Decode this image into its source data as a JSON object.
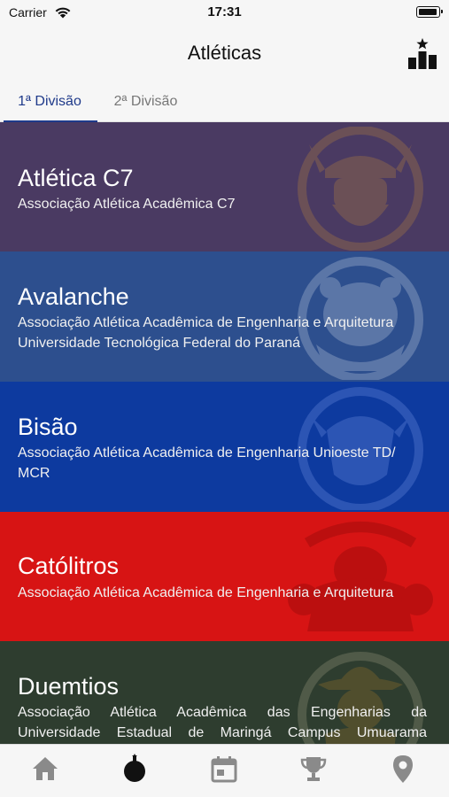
{
  "status_bar": {
    "carrier": "Carrier",
    "time": "17:31"
  },
  "header": {
    "title": "Atléticas",
    "ranking_icon": "podium-icon"
  },
  "tabs": [
    {
      "label": "1ª Divisão",
      "selected": true
    },
    {
      "label": "2ª Divisão",
      "selected": false
    }
  ],
  "teams": [
    {
      "name": "Atlética C7",
      "description": "Associação Atlética Acadêmica C7",
      "color": "#4a3a62",
      "emblem": "viking-emblem"
    },
    {
      "name": "Avalanche",
      "description": "Associação Atlética Acadêmica de Engenharia e Arquitetura Universidade Tecnológica Federal do Paraná",
      "color": "#2d4f8e",
      "emblem": "polar-bear-emblem"
    },
    {
      "name": "Bisão",
      "description": "Associação Atlética Acadêmica de Engenharia Unioeste TD/ MCR",
      "color": "#0d3a9f",
      "emblem": "bison-emblem"
    },
    {
      "name": "Católitros",
      "description": "Associação Atlética Acadêmica de Engenharia e Arquitetura",
      "color": "#d71414",
      "emblem": "muscle-monster-emblem"
    },
    {
      "name": "Duemtios",
      "description": "Associação Atlética Acadêmica das Engenharias da Universidade Estadual de Maringá Campus Umuarama",
      "color": "#2e3d2f",
      "emblem": "cowboy-emblem"
    }
  ],
  "tab_bar": {
    "items": [
      {
        "icon": "home-icon",
        "active": false
      },
      {
        "icon": "bomb-icon",
        "active": true
      },
      {
        "icon": "calendar-icon",
        "active": false
      },
      {
        "icon": "trophy-icon",
        "active": false
      },
      {
        "icon": "location-pin-icon",
        "active": false
      }
    ],
    "active_color": "#111111",
    "inactive_color": "#8a8a8a"
  }
}
